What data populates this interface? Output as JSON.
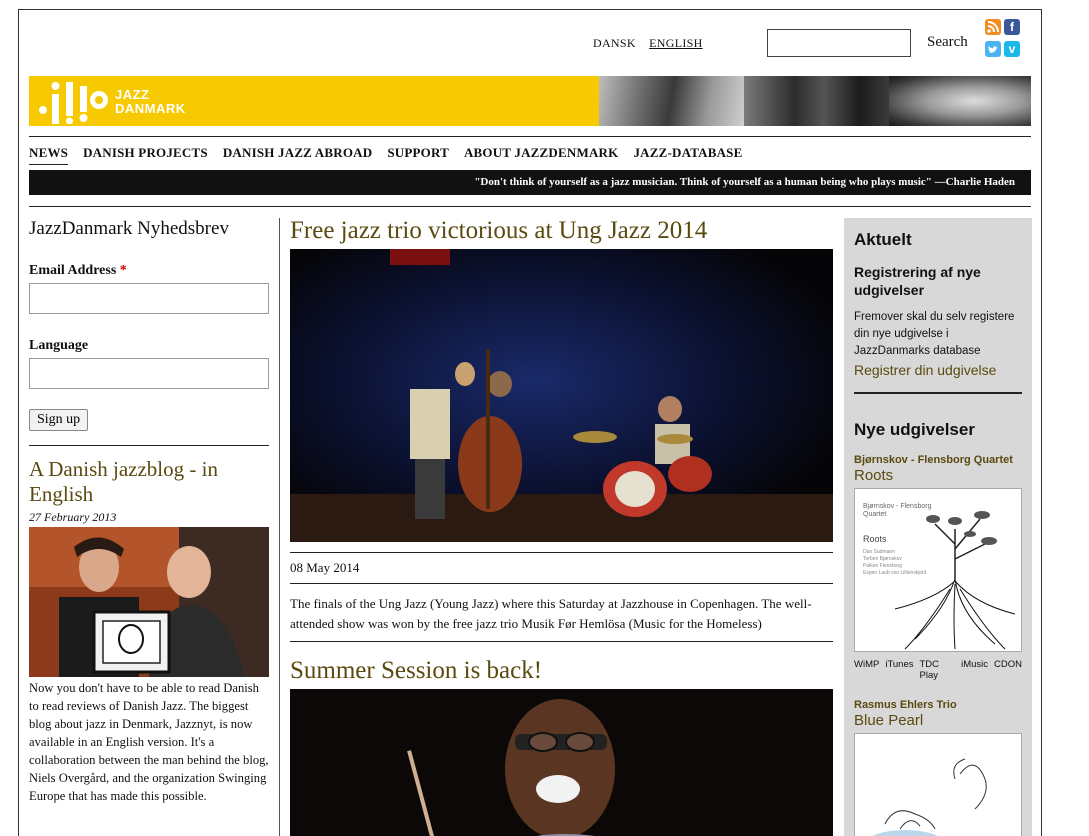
{
  "top": {
    "languages": [
      "DANSK",
      "ENGLISH"
    ],
    "active_language": "ENGLISH",
    "search_label": "Search",
    "social_icons": [
      "rss-icon",
      "facebook-icon",
      "twitter-icon",
      "vimeo-icon"
    ]
  },
  "brand": {
    "logo_line1": "JAZZ",
    "logo_line2": "DANMARK",
    "accent": "#f7c900"
  },
  "nav": {
    "items": [
      "NEWS",
      "DANISH PROJECTS",
      "DANISH JAZZ ABROAD",
      "SUPPORT",
      "ABOUT JAZZDENMARK",
      "JAZZ-DATABASE"
    ],
    "active": "NEWS"
  },
  "quote": "\"Don't think of yourself as a jazz musician. Think of yourself as a human being who plays music\" —Charlie Haden",
  "newsletter": {
    "title": "JazzDanmark Nyhedsbrev",
    "email_label": "Email Address",
    "required_mark": "*",
    "language_label": "Language",
    "signup_label": "Sign up"
  },
  "blog": {
    "title": "A Danish jazzblog - in English",
    "date": "27 February 2013",
    "text": "Now you don't have to be able to read Danish to read reviews of Danish Jazz. The biggest blog about jazz in Denmark, Jazznyt, is now available in an English version. It's a collaboration between the man behind the blog, Niels Overgård, and the organization Swinging Europe that has made this possible."
  },
  "articles": [
    {
      "title": "Free jazz trio victorious at Ung Jazz 2014",
      "date": "08 May 2014",
      "text": "The finals of the Ung Jazz (Young Jazz) where this Saturday at Jazzhouse in Copenhagen. The well-attended show was won by the free jazz trio Musik Før Hemlösa (Music for the Homeless)"
    },
    {
      "title": "Summer Session is back!"
    }
  ],
  "sidebar": {
    "aktuelt_heading": "Aktuelt",
    "aktuelt_title": "Registrering af nye udgivelser",
    "aktuelt_text": "Fremover skal du selv registere din nye udgivelse i JazzDanmarks database",
    "aktuelt_link": "Registrer din udgivelse",
    "releases_heading": "Nye udgivelser",
    "releases": [
      {
        "artist": "Bjørnskov - Flensborg Quartet",
        "album": "Roots",
        "cover_band": "Bjørnskov - Flensborg Quartet",
        "cover_title": "Roots",
        "cover_members": [
          "Dan Sudmann",
          "Torben Bjørnskov",
          "Palken Flensborg",
          "Espen Laub von Lillienskjold"
        ]
      },
      {
        "artist": "Rasmus Ehlers Trio",
        "album": "Blue Pearl"
      }
    ],
    "stores": [
      "WiMP",
      "iTunes",
      "TDC Play",
      "iMusic",
      "CDON"
    ]
  }
}
